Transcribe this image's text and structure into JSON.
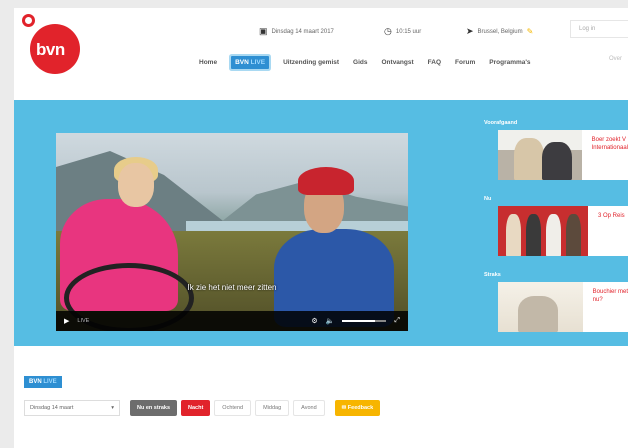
{
  "brand": {
    "logo_text": "bvn",
    "red": "#e1232b",
    "blue": "#56bde3",
    "live_blue": "#2e8fd2"
  },
  "topbar": {
    "date": "Dinsdag 14 maart 2017",
    "time": "10:15 uur",
    "location": "Brussel, Belgium",
    "login": "Log in",
    "icons": [
      "calendar-icon",
      "clock-icon",
      "location-arrow-icon",
      "pencil-icon"
    ]
  },
  "nav": {
    "items": [
      "Home",
      "Uitzending gemist",
      "Gids",
      "Ontvangst",
      "FAQ",
      "Forum",
      "Programma's"
    ],
    "live_prefix": "BVN",
    "live_suffix": "LIVE",
    "more": "Over"
  },
  "player": {
    "subtitle": "Ik zie het niet meer zitten",
    "time": "LIVE",
    "volume_level": 0.75,
    "icons": [
      "play-icon",
      "settings-icon",
      "volume-icon",
      "fullscreen-icon"
    ]
  },
  "sidebar": {
    "sections": [
      {
        "heading": "Voorafgaand",
        "title_line1": "Boer zoekt V",
        "title_line2": "Internationaal"
      },
      {
        "heading": "Nu",
        "title_line1": "3 Op Reis",
        "title_line2": ""
      },
      {
        "heading": "Straks",
        "title_line1": "Bouchier met",
        "title_line2": "nu?"
      }
    ]
  },
  "schedule": {
    "live_prefix": "BVN",
    "live_suffix": "LIVE",
    "day_select": "Dinsdag 14 maart",
    "now_label": "Nu en straks",
    "night_label": "Nacht",
    "parts": [
      "Ochtend",
      "Middag",
      "Avond"
    ],
    "feedback_label": "Feedback"
  }
}
